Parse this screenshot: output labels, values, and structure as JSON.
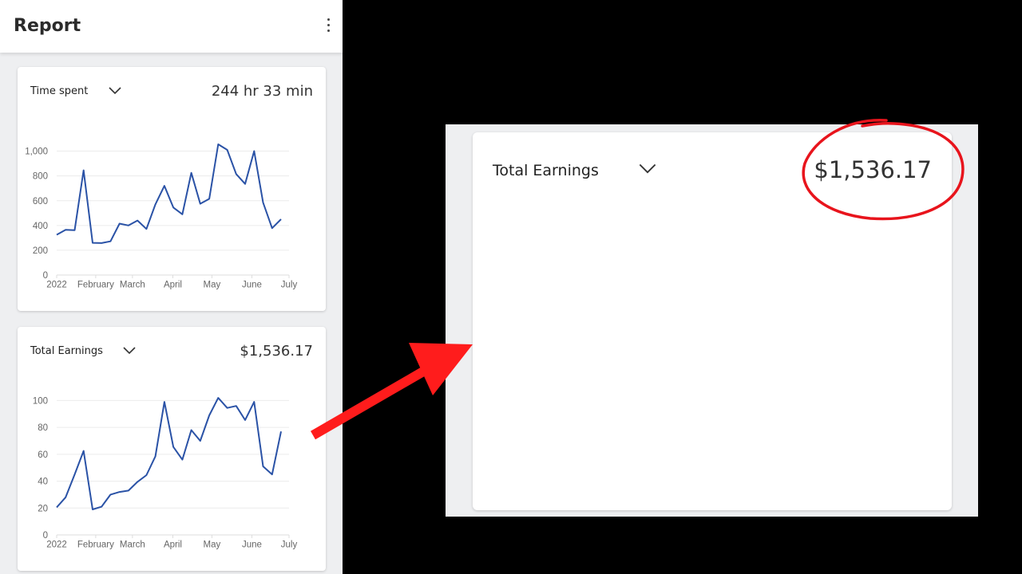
{
  "app": {
    "title": "Report",
    "menu_icon": "more-vertical-icon"
  },
  "cards": [
    {
      "label": "Time spent",
      "value": "244 hr 33 min",
      "dropdown_icon": "chevron-down-icon"
    },
    {
      "label": "Total Earnings",
      "value": "$1,536.17",
      "dropdown_icon": "chevron-down-icon"
    }
  ],
  "zoomed_card": {
    "label": "Total Earnings",
    "value": "$1,536.17",
    "dropdown_icon": "chevron-down-icon"
  },
  "annotations": {
    "arrow_color": "#ff1c1c",
    "circle_color": "#e8141c"
  },
  "colors": {
    "line": "#2a52a6",
    "grid": "#ececec",
    "axis_text": "#666666"
  },
  "chart_data": [
    {
      "type": "line",
      "title": "Time spent",
      "x_tick_labels": [
        "2022",
        "February",
        "March",
        "April",
        "May",
        "June",
        "July"
      ],
      "y_ticks": [
        0,
        200,
        400,
        600,
        800,
        1000
      ],
      "y_tick_labels": [
        "0",
        "200",
        "400",
        "600",
        "800",
        "1,000"
      ],
      "ylim": [
        0,
        1100
      ],
      "grid": true,
      "series": [
        {
          "name": "Time spent",
          "values": [
            325,
            365,
            362,
            845,
            260,
            258,
            272,
            415,
            400,
            440,
            372,
            570,
            720,
            545,
            490,
            825,
            575,
            615,
            1055,
            1010,
            815,
            735,
            1000,
            585,
            378,
            450
          ]
        }
      ]
    },
    {
      "type": "line",
      "title": "Total Earnings",
      "x_tick_labels": [
        "2022",
        "February",
        "March",
        "April",
        "May",
        "June",
        "July"
      ],
      "y_ticks": [
        0,
        20,
        40,
        60,
        80,
        100
      ],
      "y_tick_labels": [
        "0",
        "20",
        "40",
        "60",
        "80",
        "100"
      ],
      "ylim": [
        0,
        105
      ],
      "grid": true,
      "series": [
        {
          "name": "Total Earnings",
          "values": [
            20.5,
            28,
            45,
            62.5,
            19,
            21,
            30,
            32,
            33,
            39.5,
            44.5,
            58.5,
            99,
            65.5,
            56,
            78,
            70,
            89,
            102,
            94.5,
            96,
            85.5,
            99,
            51,
            45,
            77
          ]
        }
      ]
    }
  ]
}
